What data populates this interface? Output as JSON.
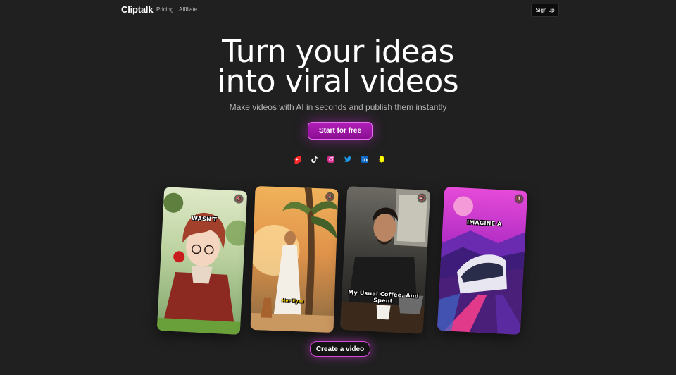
{
  "nav": {
    "brand": "Cliptalk",
    "links": [
      "Pricing",
      "Affiliate"
    ],
    "signup": "Sign up"
  },
  "hero": {
    "title_line1": "Turn your ideas",
    "title_line2": "into viral videos",
    "subtitle": "Make videos with AI in seconds and publish them instantly",
    "cta": "Start for free"
  },
  "socials": [
    {
      "icon": "youtube-shorts-icon",
      "color": "#ff2a2a"
    },
    {
      "icon": "tiktok-icon",
      "color": "#ffffff"
    },
    {
      "icon": "instagram-icon",
      "color": "#e1306c"
    },
    {
      "icon": "twitter-icon",
      "color": "#1d9bf0"
    },
    {
      "icon": "linkedin-icon",
      "color": "#0a66c2"
    },
    {
      "icon": "snapchat-icon",
      "color": "#fffc00"
    }
  ],
  "videos": [
    {
      "caption": "WASN'T"
    },
    {
      "caption": "Her Eyes"
    },
    {
      "caption": "My Usual Coffee, And Spent"
    },
    {
      "caption": "IMAGINE A"
    }
  ],
  "mute_icon": "mute-icon",
  "create_button": "Create a video",
  "colors": {
    "background": "#202020",
    "accent": "#a618ae"
  }
}
